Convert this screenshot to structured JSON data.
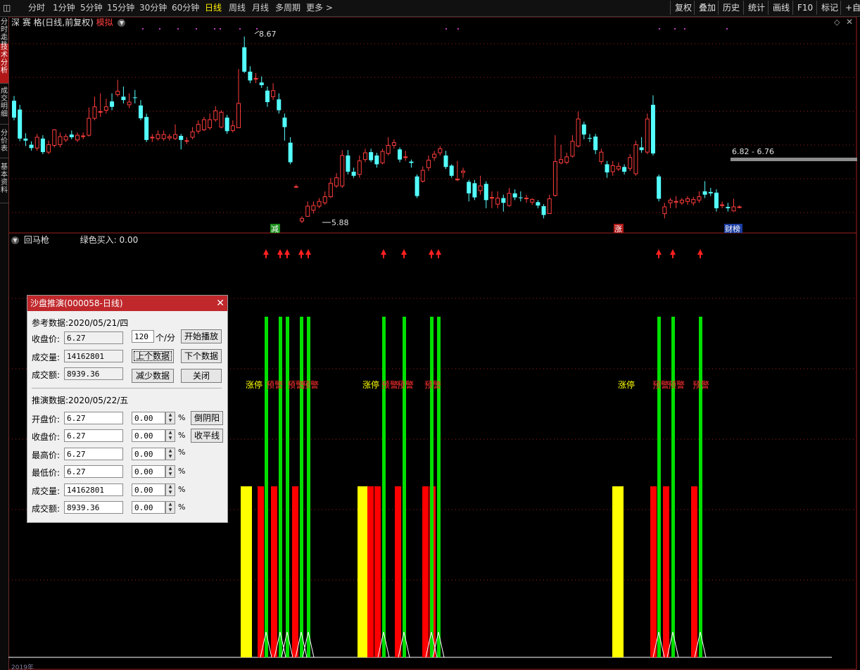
{
  "toolbar": {
    "tabs": [
      "分时",
      "1分钟",
      "5分钟",
      "15分钟",
      "30分钟",
      "60分钟",
      "日线",
      "周线",
      "月线",
      "多周期",
      "更多 >"
    ],
    "active_tab": "日线",
    "right_buttons": [
      "复权",
      "叠加",
      "历史",
      "统计",
      "画线",
      "F10",
      "标记",
      "+自选"
    ]
  },
  "sidebar": {
    "items": [
      "分时走势",
      "技术分析",
      "成交明细",
      "分价表",
      "基本资料"
    ],
    "active": "技术分析"
  },
  "main_chart": {
    "title": "深 赛 格(日线,前复权)",
    "mode_label": "模拟",
    "high_label": "8.67",
    "low_label": "5.88",
    "range_label": "6.82 - 6.76",
    "event_tags": [
      {
        "text": "减",
        "color": "#1a8c1a"
      },
      {
        "text": "涨",
        "color": "#b01818"
      },
      {
        "text": "财榜",
        "color": "#1a3ca0"
      }
    ]
  },
  "colors": {
    "up": "#ff3c3c",
    "down": "#54ffff",
    "green": "#00e000",
    "yellow": "#ffff00",
    "red": "#ff0000"
  },
  "candles": [
    {
      "o": 7.69,
      "c": 7.44,
      "h": 7.76,
      "l": 7.4
    },
    {
      "o": 7.56,
      "c": 7.13,
      "h": 7.63,
      "l": 7.09
    },
    {
      "o": 7.13,
      "c": 7.1,
      "h": 7.21,
      "l": 7.02
    },
    {
      "o": 7.04,
      "c": 6.99,
      "h": 7.09,
      "l": 6.95
    },
    {
      "o": 6.99,
      "c": 7.15,
      "h": 7.2,
      "l": 6.95
    },
    {
      "o": 7.13,
      "c": 6.93,
      "h": 7.18,
      "l": 6.9
    },
    {
      "o": 6.93,
      "c": 7.04,
      "h": 7.1,
      "l": 6.9
    },
    {
      "o": 7.03,
      "c": 7.26,
      "h": 7.27,
      "l": 7.0
    },
    {
      "o": 7.04,
      "c": 7.16,
      "h": 7.22,
      "l": 7.0
    },
    {
      "o": 7.11,
      "c": 7.16,
      "h": 7.2,
      "l": 7.08
    },
    {
      "o": 7.19,
      "c": 7.15,
      "h": 7.25,
      "l": 7.12
    },
    {
      "o": 7.11,
      "c": 7.18,
      "h": 7.22,
      "l": 7.08
    },
    {
      "o": 7.16,
      "c": 7.17,
      "h": 7.22,
      "l": 7.12
    },
    {
      "o": 7.18,
      "c": 7.43,
      "h": 7.59,
      "l": 7.16
    },
    {
      "o": 7.43,
      "c": 7.6,
      "h": 7.75,
      "l": 7.4
    },
    {
      "o": 7.53,
      "c": 7.53,
      "h": 7.8,
      "l": 7.45
    },
    {
      "o": 7.55,
      "c": 7.6,
      "h": 7.72,
      "l": 7.5
    },
    {
      "o": 7.68,
      "c": 7.6,
      "h": 7.8,
      "l": 7.55
    },
    {
      "o": 7.78,
      "c": 7.83,
      "h": 8.0,
      "l": 7.75
    },
    {
      "o": 7.75,
      "c": 7.7,
      "h": 7.9,
      "l": 7.65
    },
    {
      "o": 7.63,
      "c": 7.67,
      "h": 7.8,
      "l": 7.58
    },
    {
      "o": 7.74,
      "c": 7.73,
      "h": 7.85,
      "l": 7.65
    },
    {
      "o": 7.62,
      "c": 7.43,
      "h": 7.7,
      "l": 7.4
    },
    {
      "o": 7.45,
      "c": 7.11,
      "h": 7.5,
      "l": 7.08
    },
    {
      "o": 7.14,
      "c": 7.15,
      "h": 7.2,
      "l": 7.08
    },
    {
      "o": 7.13,
      "c": 7.19,
      "h": 7.25,
      "l": 7.1
    },
    {
      "o": 7.13,
      "c": 7.19,
      "h": 7.25,
      "l": 7.1
    },
    {
      "o": 7.14,
      "c": 7.16,
      "h": 7.2,
      "l": 7.1
    },
    {
      "o": 7.13,
      "c": 7.19,
      "h": 7.34,
      "l": 7.11
    },
    {
      "o": 7.17,
      "c": 7.11,
      "h": 7.2,
      "l": 6.97
    },
    {
      "o": 7.09,
      "c": 7.1,
      "h": 7.15,
      "l": 7.05
    },
    {
      "o": 7.15,
      "c": 7.23,
      "h": 7.3,
      "l": 7.12
    },
    {
      "o": 7.24,
      "c": 7.34,
      "h": 7.4,
      "l": 7.2
    },
    {
      "o": 7.26,
      "c": 7.41,
      "h": 7.45,
      "l": 7.24
    },
    {
      "o": 7.29,
      "c": 7.41,
      "h": 7.5,
      "l": 7.26
    },
    {
      "o": 7.41,
      "c": 7.54,
      "h": 7.61,
      "l": 7.38
    },
    {
      "o": 7.3,
      "c": 7.52,
      "h": 7.55,
      "l": 7.28
    },
    {
      "o": 7.44,
      "c": 7.24,
      "h": 7.48,
      "l": 7.2
    },
    {
      "o": 7.25,
      "c": 7.32,
      "h": 7.4,
      "l": 7.22
    },
    {
      "o": 7.29,
      "c": 7.65,
      "h": 8.16,
      "l": 7.29
    },
    {
      "o": 8.48,
      "c": 8.12,
      "h": 8.64,
      "l": 8.1
    },
    {
      "o": 8.12,
      "c": 7.99,
      "h": 8.2,
      "l": 7.95
    },
    {
      "o": 8.02,
      "c": 8.02,
      "h": 8.1,
      "l": 7.95
    },
    {
      "o": 7.96,
      "c": 7.92,
      "h": 8.05,
      "l": 7.88
    },
    {
      "o": 7.84,
      "c": 7.67,
      "h": 7.9,
      "l": 7.6
    },
    {
      "o": 7.75,
      "c": 7.84,
      "h": 7.95,
      "l": 7.7
    },
    {
      "o": 7.71,
      "c": 7.55,
      "h": 7.8,
      "l": 7.5
    },
    {
      "o": 7.44,
      "c": 7.3,
      "h": 7.5,
      "l": 7.1
    },
    {
      "o": 7.07,
      "c": 6.78,
      "h": 7.15,
      "l": 6.75
    },
    {
      "o": 6.42,
      "c": 6.42,
      "h": 6.45,
      "l": 6.4
    },
    {
      "o": 5.91,
      "c": 5.95,
      "h": 5.98,
      "l": 5.88
    },
    {
      "o": 5.98,
      "c": 6.13,
      "h": 6.2,
      "l": 5.98
    },
    {
      "o": 6.07,
      "c": 6.14,
      "h": 6.2,
      "l": 6.02
    },
    {
      "o": 6.13,
      "c": 6.2,
      "h": 6.25,
      "l": 6.1
    },
    {
      "o": 6.18,
      "c": 6.27,
      "h": 6.35,
      "l": 6.15
    },
    {
      "o": 6.27,
      "c": 6.47,
      "h": 6.55,
      "l": 6.25
    },
    {
      "o": 6.43,
      "c": 6.55,
      "h": 6.62,
      "l": 6.4
    },
    {
      "o": 6.43,
      "c": 6.88,
      "h": 6.96,
      "l": 6.4
    },
    {
      "o": 6.88,
      "c": 6.64,
      "h": 6.96,
      "l": 6.6
    },
    {
      "o": 6.64,
      "c": 6.58,
      "h": 6.7,
      "l": 6.55
    },
    {
      "o": 6.6,
      "c": 6.8,
      "h": 6.88,
      "l": 6.55
    },
    {
      "o": 6.82,
      "c": 6.92,
      "h": 6.98,
      "l": 6.78
    },
    {
      "o": 6.93,
      "c": 6.81,
      "h": 6.98,
      "l": 6.78
    },
    {
      "o": 6.88,
      "c": 6.75,
      "h": 6.92,
      "l": 6.7
    },
    {
      "o": 6.77,
      "c": 6.94,
      "h": 6.98,
      "l": 6.75
    },
    {
      "o": 6.91,
      "c": 7.03,
      "h": 7.15,
      "l": 6.88
    },
    {
      "o": 7.03,
      "c": 7.07,
      "h": 7.12,
      "l": 6.98
    },
    {
      "o": 6.97,
      "c": 6.82,
      "h": 7.0,
      "l": 6.78
    },
    {
      "o": 6.86,
      "c": 6.86,
      "h": 6.95,
      "l": 6.8
    },
    {
      "o": 6.79,
      "c": 6.77,
      "h": 6.82,
      "l": 6.7
    },
    {
      "o": 6.57,
      "c": 6.28,
      "h": 6.6,
      "l": 6.25
    },
    {
      "o": 6.5,
      "c": 6.66,
      "h": 6.72,
      "l": 6.48
    },
    {
      "o": 6.7,
      "c": 6.81,
      "h": 6.88,
      "l": 6.65
    },
    {
      "o": 6.85,
      "c": 6.9,
      "h": 6.95,
      "l": 6.8
    },
    {
      "o": 6.92,
      "c": 6.98,
      "h": 7.02,
      "l": 6.88
    },
    {
      "o": 6.88,
      "c": 6.71,
      "h": 6.95,
      "l": 6.68
    },
    {
      "o": 6.73,
      "c": 6.58,
      "h": 6.75,
      "l": 6.55
    },
    {
      "o": 6.53,
      "c": 6.53,
      "h": 6.8,
      "l": 6.5
    },
    {
      "o": 6.63,
      "c": 6.65,
      "h": 6.7,
      "l": 6.55
    },
    {
      "o": 6.49,
      "c": 6.32,
      "h": 6.52,
      "l": 6.2
    },
    {
      "o": 6.47,
      "c": 6.26,
      "h": 6.52,
      "l": 6.22
    },
    {
      "o": 6.36,
      "c": 6.43,
      "h": 6.58,
      "l": 6.3
    },
    {
      "o": 6.46,
      "c": 6.22,
      "h": 6.5,
      "l": 6.1
    },
    {
      "o": 6.25,
      "c": 6.26,
      "h": 6.35,
      "l": 6.1
    },
    {
      "o": 6.16,
      "c": 6.25,
      "h": 6.35,
      "l": 6.1
    },
    {
      "o": 6.25,
      "c": 6.18,
      "h": 6.3,
      "l": 6.05
    },
    {
      "o": 6.14,
      "c": 6.32,
      "h": 6.4,
      "l": 6.12
    },
    {
      "o": 6.32,
      "c": 6.26,
      "h": 6.38,
      "l": 6.22
    },
    {
      "o": 6.26,
      "c": 6.25,
      "h": 6.35,
      "l": 6.2
    },
    {
      "o": 6.24,
      "c": 6.25,
      "h": 6.3,
      "l": 6.18
    },
    {
      "o": 6.19,
      "c": 6.23,
      "h": 6.25,
      "l": 6.15
    },
    {
      "o": 6.19,
      "c": 6.14,
      "h": 6.22,
      "l": 6.1
    },
    {
      "o": 6.13,
      "c": 6.0,
      "h": 6.16,
      "l": 5.95
    },
    {
      "o": 6.02,
      "c": 6.24,
      "h": 6.3,
      "l": 6.02
    },
    {
      "o": 6.29,
      "c": 6.79,
      "h": 7.18,
      "l": 6.27
    },
    {
      "o": 6.77,
      "c": 6.82,
      "h": 7.04,
      "l": 6.75
    },
    {
      "o": 6.78,
      "c": 6.86,
      "h": 6.92,
      "l": 6.75
    },
    {
      "o": 6.87,
      "c": 7.09,
      "h": 7.18,
      "l": 6.85
    },
    {
      "o": 7.02,
      "c": 7.42,
      "h": 7.53,
      "l": 7.0
    },
    {
      "o": 7.34,
      "c": 7.19,
      "h": 7.38,
      "l": 7.12
    },
    {
      "o": 7.14,
      "c": 7.13,
      "h": 7.2,
      "l": 7.08
    },
    {
      "o": 7.16,
      "c": 6.96,
      "h": 7.2,
      "l": 6.9
    },
    {
      "o": 6.79,
      "c": 6.93,
      "h": 6.98,
      "l": 6.75
    },
    {
      "o": 6.75,
      "c": 6.63,
      "h": 6.8,
      "l": 6.55
    },
    {
      "o": 6.64,
      "c": 6.73,
      "h": 6.8,
      "l": 6.58
    },
    {
      "o": 6.68,
      "c": 6.72,
      "h": 6.78,
      "l": 6.65
    },
    {
      "o": 6.71,
      "c": 6.64,
      "h": 6.75,
      "l": 6.6
    },
    {
      "o": 6.69,
      "c": 6.85,
      "h": 6.9,
      "l": 6.65
    },
    {
      "o": 6.61,
      "c": 7.04,
      "h": 7.1,
      "l": 6.58
    },
    {
      "o": 7.0,
      "c": 6.96,
      "h": 7.15,
      "l": 6.92
    },
    {
      "o": 6.93,
      "c": 7.42,
      "h": 7.5,
      "l": 6.9
    },
    {
      "o": 7.63,
      "c": 6.91,
      "h": 7.77,
      "l": 6.88
    },
    {
      "o": 6.57,
      "c": 6.24,
      "h": 6.6,
      "l": 6.2
    },
    {
      "o": 6.02,
      "c": 6.12,
      "h": 6.18,
      "l": 5.95
    },
    {
      "o": 6.18,
      "c": 6.22,
      "h": 6.25,
      "l": 6.1
    },
    {
      "o": 6.2,
      "c": 6.2,
      "h": 6.28,
      "l": 6.1
    },
    {
      "o": 6.18,
      "c": 6.22,
      "h": 6.25,
      "l": 6.15
    },
    {
      "o": 6.2,
      "c": 6.24,
      "h": 6.28,
      "l": 6.15
    },
    {
      "o": 6.18,
      "c": 6.23,
      "h": 6.27,
      "l": 6.14
    },
    {
      "o": 6.22,
      "c": 6.27,
      "h": 6.35,
      "l": 6.18
    },
    {
      "o": 6.35,
      "c": 6.3,
      "h": 6.5,
      "l": 6.25
    },
    {
      "o": 6.34,
      "c": 6.32,
      "h": 6.4,
      "l": 6.28
    },
    {
      "o": 6.33,
      "c": 6.1,
      "h": 6.38,
      "l": 6.05
    },
    {
      "o": 6.15,
      "c": 6.15,
      "h": 6.2,
      "l": 6.1
    },
    {
      "o": 6.12,
      "c": 6.1,
      "h": 6.18,
      "l": 6.05
    },
    {
      "o": 6.06,
      "c": 6.12,
      "h": 6.24,
      "l": 6.05
    },
    {
      "o": 6.12,
      "c": 6.12,
      "h": 6.14,
      "l": 6.1
    }
  ],
  "indicator": {
    "name": "回马枪",
    "value_label": "绿色买入: 0.00",
    "signal_labels": [
      {
        "text": "涨停",
        "color": "#ffff00"
      },
      {
        "text": "预警",
        "color": "#ff3030"
      },
      {
        "text": "预警",
        "color": "#ff3030"
      },
      {
        "text": "预警",
        "color": "#ff3030"
      },
      {
        "text": "涨停",
        "color": "#ffff00"
      },
      {
        "text": "预警",
        "color": "#ff3030"
      },
      {
        "text": "预警",
        "color": "#ff3030"
      },
      {
        "text": "预警",
        "color": "#ff3030"
      },
      {
        "text": "涨停",
        "color": "#ffff00"
      },
      {
        "text": "预警",
        "color": "#ff3030"
      },
      {
        "text": "预警",
        "color": "#ff3030"
      },
      {
        "text": "预警",
        "color": "#ff3030"
      }
    ],
    "arrows": 12,
    "green_lines": 12,
    "bottom_axis_label": "2019年"
  },
  "dialog": {
    "title": "沙盘推演(000058-日线)",
    "ref_label": "参考数据:2020/05/21/四",
    "close_label": "收盘价:",
    "close_value": "6.27",
    "volume_label": "成交量:",
    "volume_value": "14162801",
    "amount_label": "成交额:",
    "amount_value": "8939.36",
    "speed_value": "120",
    "speed_unit": "个/分",
    "btn_play": "开始播放",
    "btn_prev": "上个数据",
    "btn_next": "下个数据",
    "btn_less": "减少数据",
    "btn_close": "关闭",
    "pred_label": "推演数据:2020/05/22/五",
    "rows": [
      {
        "label": "开盘价:",
        "value": "6.27",
        "pct": "0.00"
      },
      {
        "label": "收盘价:",
        "value": "6.27",
        "pct": "0.00"
      },
      {
        "label": "最高价:",
        "value": "6.27",
        "pct": "0.00"
      },
      {
        "label": "最低价:",
        "value": "6.27",
        "pct": "0.00"
      },
      {
        "label": "成交量:",
        "value": "14162801",
        "pct": "0.00"
      },
      {
        "label": "成交额:",
        "value": "8939.36",
        "pct": "0.00"
      }
    ],
    "pct_sign": "%",
    "btn_invert": "倒阴阳",
    "btn_flat": "收平线"
  }
}
